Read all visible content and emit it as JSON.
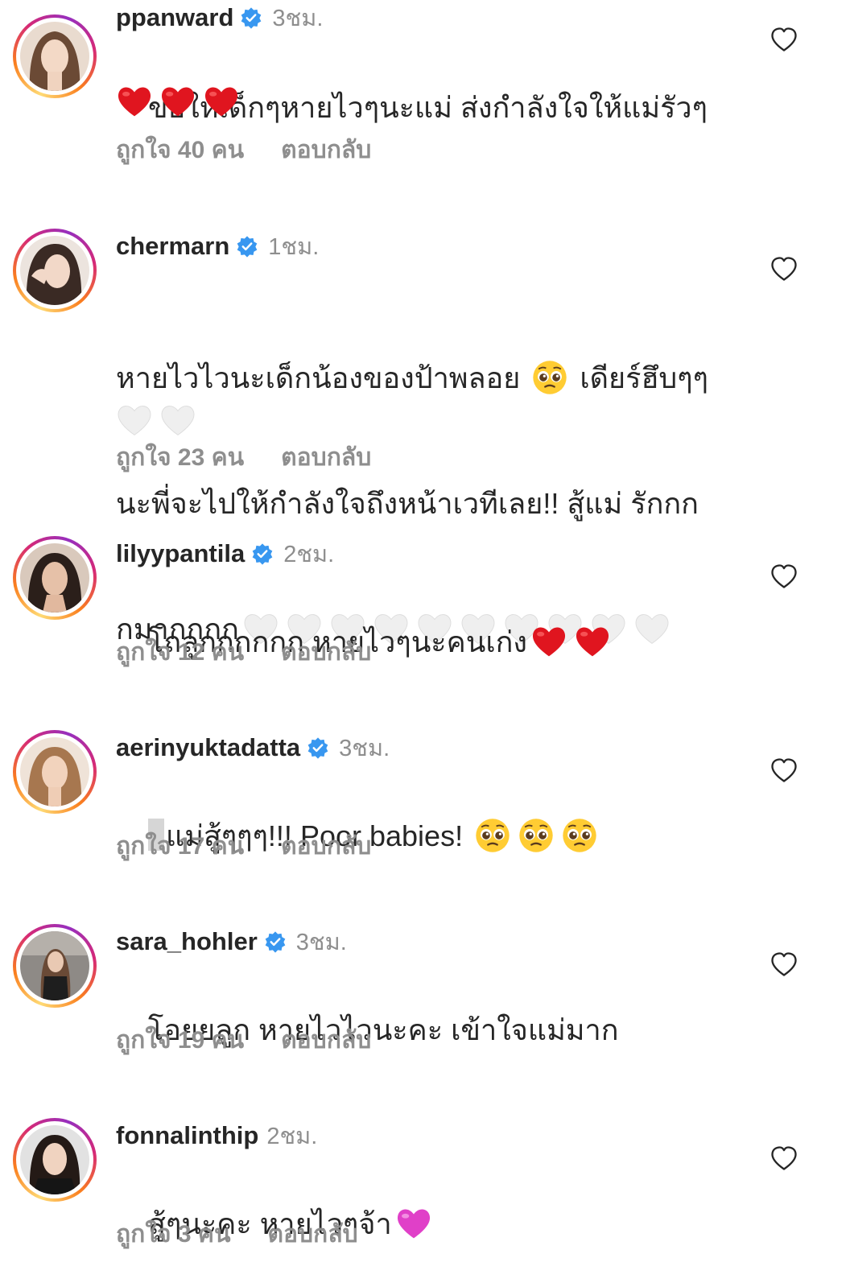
{
  "comments": [
    {
      "username": "ppanward",
      "verified": true,
      "time": "3ชม.",
      "text_lines": [
        "ขอให้เด็กๆหายไวๆนะแม่ ส่งกำลังใจให้แม่รัวๆ"
      ],
      "emoji_lines": [
        [
          "red-heart",
          "red-heart",
          "red-heart"
        ]
      ],
      "likes": "ถูกใจ 40 คน",
      "reply": "ตอบกลับ"
    },
    {
      "username": "chermarn",
      "verified": true,
      "time": "1ชม.",
      "text_lines": [
        "หายไวไวนะเด็กน้องของป้าพลอย",
        "เดียร์ฮึบๆๆ",
        "นะพี่จะไปให้กำลังใจถึงหน้าเวทีเลย!! สู้แม่ รักกก",
        "กมากกกก"
      ],
      "emoji_lines": [
        [
          "white-heart",
          "white-heart"
        ]
      ],
      "likes": "ถูกใจ 23 คน",
      "reply": "ตอบกลับ"
    },
    {
      "username": "lilyypantila",
      "verified": true,
      "time": "2ชม.",
      "text_lines": [
        "โถลูกกกกกก หายไวๆนะคนเก่ง"
      ],
      "likes": "ถูกใจ 12 คน",
      "reply": "ตอบกลับ"
    },
    {
      "username": "aerinyuktadatta",
      "verified": true,
      "time": "3ชม.",
      "text_lines": [
        "แม่สู้ๆๆๆ!!! Poor babies!"
      ],
      "likes": "ถูกใจ 17 คน",
      "reply": "ตอบกลับ"
    },
    {
      "username": "sara_hohler",
      "verified": true,
      "time": "3ชม.",
      "text_lines": [
        "โอยยลูก หายไวไวนะคะ เข้าใจแม่มาก"
      ],
      "likes": "ถูกใจ 19 คน",
      "reply": "ตอบกลับ"
    },
    {
      "username": "fonnalinthip",
      "verified": false,
      "time": "2ชม.",
      "text_lines": [
        "สู้ๆนะคะ หายไวๆจ้า"
      ],
      "likes": "ถูกใจ 3 คน",
      "reply": "ตอบกลับ"
    }
  ],
  "colors": {
    "text": "#262626",
    "secondary": "#8e8e8e",
    "verified": "#3897f0",
    "red_heart": "#e0151f",
    "white_heart": "#efefef",
    "pink_heart": "#e040c8"
  },
  "icons": {
    "like": "heart-outline-icon",
    "verified": "verified-badge-icon",
    "pleading": "pleading-face-emoji"
  }
}
